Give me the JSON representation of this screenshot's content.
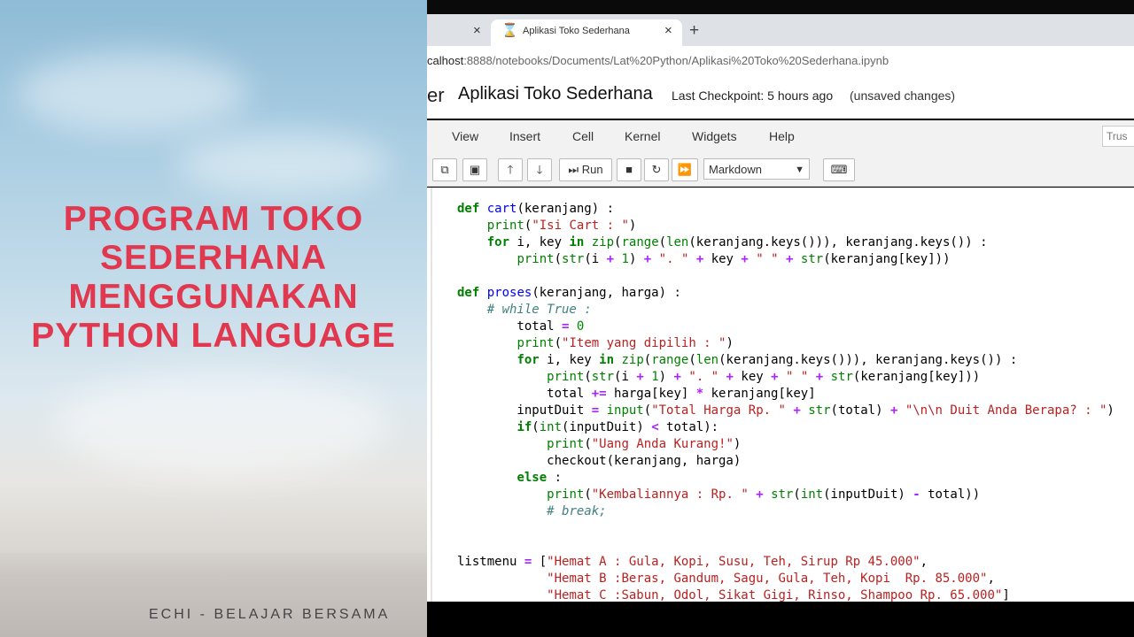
{
  "promo": {
    "title_lines": [
      "PROGRAM TOKO",
      "SEDERHANA",
      "MENGGUNAKAN",
      "PYTHON LANGUAGE"
    ],
    "credit": "ECHI - BELAJAR BERSAMA",
    "title_color": "#e0384f"
  },
  "browser": {
    "tabs": [
      {
        "label": "",
        "close": "×"
      },
      {
        "label": "Aplikasi Toko Sederhana",
        "icon": "hourglass-icon",
        "close": "×"
      }
    ],
    "new_tab": "+",
    "url_host": "calhost",
    "url_rest": ":8888/notebooks/Documents/Lat%20Python/Aplikasi%20Toko%20Sederhana.ipynb"
  },
  "notebook": {
    "logo_fragment": "er",
    "title": "Aplikasi Toko Sederhana",
    "checkpoint": "Last Checkpoint: 5 hours ago",
    "unsaved": "(unsaved changes)",
    "menu": [
      "View",
      "Insert",
      "Cell",
      "Kernel",
      "Widgets",
      "Help"
    ],
    "trust": "Trus",
    "toolbar": {
      "run_label": "Run",
      "cell_type": "Markdown"
    }
  },
  "code_lines": [
    "def cart(keranjang) :",
    "    print(\"Isi Cart : \")",
    "    for i, key in zip(range(len(keranjang.keys())), keranjang.keys()) :",
    "        print(str(i + 1) + \". \" + key + \" \" + str(keranjang[key]))",
    "",
    "def proses(keranjang, harga) :",
    "    # while True :",
    "        total = 0",
    "        print(\"Item yang dipilih : \")",
    "        for i, key in zip(range(len(keranjang.keys())), keranjang.keys()) :",
    "            print(str(i + 1) + \". \" + key + \" \" + str(keranjang[key]))",
    "            total += harga[key] * keranjang[key]",
    "        inputDuit = input(\"Total Harga Rp. \" + str(total) + \"\\n\\n Duit Anda Berapa? : \")",
    "        if(int(inputDuit) < total):",
    "            print(\"Uang Anda Kurang!\")",
    "            checkout(keranjang, harga)",
    "        else :",
    "            print(\"Kembaliannya : Rp. \" + str(int(inputDuit) - total))",
    "            # break;",
    "",
    "",
    "listmenu = [\"Hemat A : Gula, Kopi, Susu, Teh, Sirup Rp 45.000\",",
    "            \"Hemat B :Beras, Gandum, Sagu, Gula, Teh, Kopi  Rp. 85.000\",",
    "            \"Hemat C :Sabun, Odol, Sikat Gigi, Rinso, Shampoo Rp. 65.000\"]"
  ]
}
